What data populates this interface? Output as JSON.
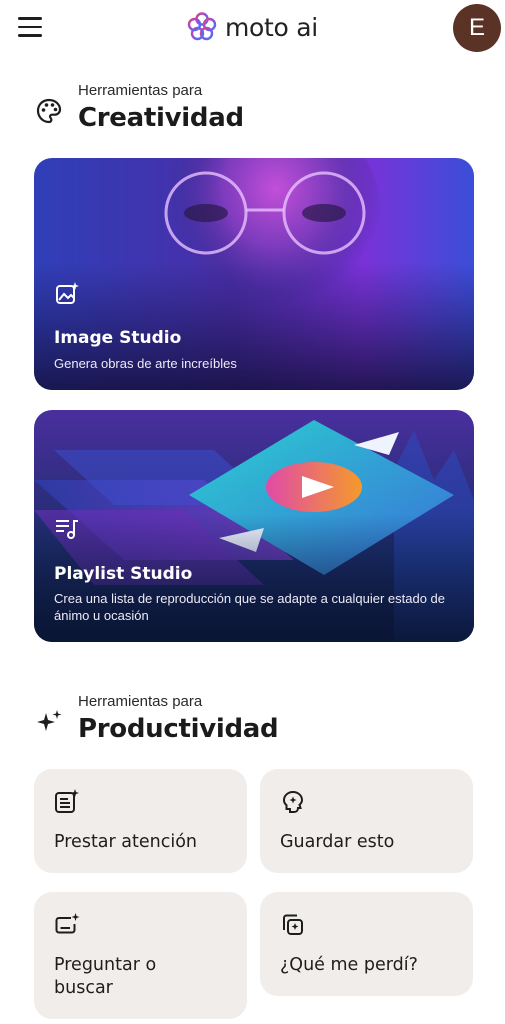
{
  "header": {
    "brand": "moto ai",
    "avatar_initial": "E",
    "icons": {
      "menu": "menu-icon",
      "logo": "moto-ai-logo-icon"
    }
  },
  "creativity": {
    "subtitle": "Herramientas para",
    "title": "Creatividad",
    "icon": "palette-icon",
    "cards": [
      {
        "title": "Image Studio",
        "description": "Genera obras de arte increíbles",
        "icon": "image-sparkle-icon"
      },
      {
        "title": "Playlist Studio",
        "description": "Crea una lista de reproducción que se adapte a cualquier estado de ánimo u ocasión",
        "icon": "playlist-music-icon"
      }
    ]
  },
  "productivity": {
    "subtitle": "Herramientas para",
    "title": "Productividad",
    "icon": "sparkles-icon",
    "tiles": [
      {
        "label": "Prestar atención",
        "icon": "note-sparkle-icon"
      },
      {
        "label": "Guardar esto",
        "icon": "brain-sparkle-icon"
      },
      {
        "label": "Preguntar o buscar",
        "icon": "message-sparkle-icon"
      },
      {
        "label": "¿Qué me perdí?",
        "icon": "stack-sparkle-icon"
      }
    ]
  },
  "colors": {
    "avatar_bg": "#5b3326",
    "tile_bg": "#f0edea",
    "image_card_accent": "#6a3df0",
    "playlist_card_bg": "#1f2a5c"
  }
}
